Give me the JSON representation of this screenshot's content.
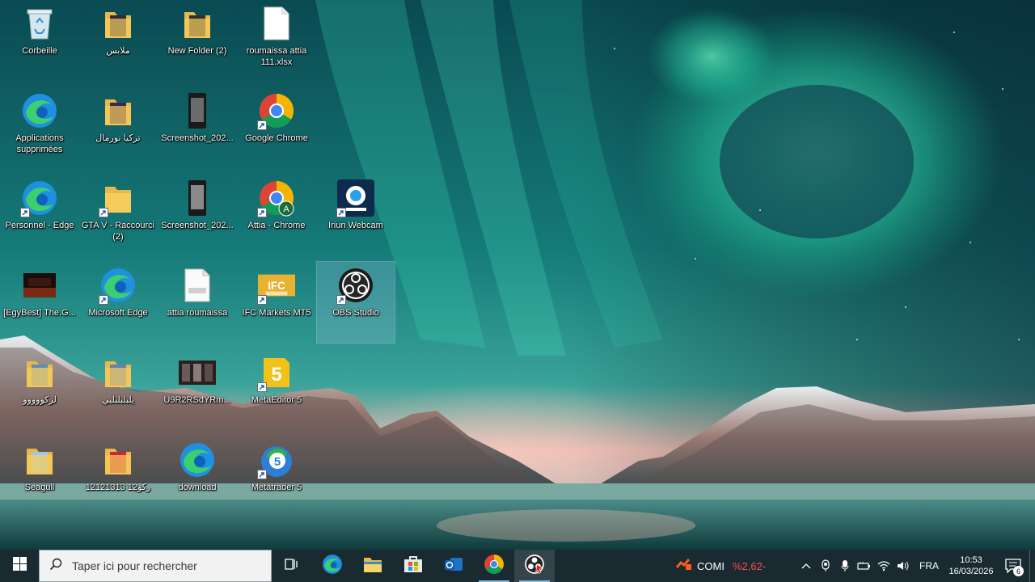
{
  "desktop": {
    "icons": [
      {
        "label": "Corbeille",
        "icon": "recycle-bin-icon"
      },
      {
        "label": "ملابس",
        "icon": "folder-icon"
      },
      {
        "label": "New Folder (2)",
        "icon": "folder-icon"
      },
      {
        "label": "roumaissa attia 111.xlsx",
        "icon": "file-icon"
      },
      {
        "label": "Applications supprimées",
        "icon": "edge-icon"
      },
      {
        "label": "تركيا نورمال",
        "icon": "folder-icon"
      },
      {
        "label": "Screenshot_202...",
        "icon": "phone-screenshot-icon"
      },
      {
        "label": "Google Chrome",
        "icon": "chrome-icon"
      },
      {
        "label": "Personnel - Edge",
        "icon": "edge-icon"
      },
      {
        "label": "GTA V - Raccourci (2)",
        "icon": "folder-icon"
      },
      {
        "label": "Screenshot_202...",
        "icon": "phone-screenshot-icon"
      },
      {
        "label": "Attia - Chrome",
        "icon": "chrome-profile-icon"
      },
      {
        "label": "Iriun Webcam",
        "icon": "webcam-icon"
      },
      {
        "label": "[EgyBest] The.G...",
        "icon": "video-icon"
      },
      {
        "label": "Microsoft Edge",
        "icon": "edge-icon"
      },
      {
        "label": "attia roumaissa",
        "icon": "docx-icon"
      },
      {
        "label": "IFC Markets MT5",
        "icon": "mt5-broker-icon"
      },
      {
        "label": "OBS Studio",
        "icon": "obs-icon"
      },
      {
        "label": "لركووووو",
        "icon": "folder-icon"
      },
      {
        "label": "يلبلبلبلبي",
        "icon": "folder-icon"
      },
      {
        "label": "U9R2RSdYRm...",
        "icon": "image-thumbnail-icon"
      },
      {
        "label": "MetaEditor 5",
        "icon": "metaeditor-icon"
      },
      {
        "label": "Seagull",
        "icon": "folder-icon"
      },
      {
        "label": "12121313 12ركو",
        "icon": "folder-icon"
      },
      {
        "label": "download",
        "icon": "edge-icon"
      },
      {
        "label": "Metatrader 5",
        "icon": "metatrader-icon"
      }
    ]
  },
  "taskbar": {
    "search_placeholder": "Taper ici pour rechercher",
    "apps": [
      {
        "name": "task-view-icon"
      },
      {
        "name": "edge-icon"
      },
      {
        "name": "file-explorer-icon"
      },
      {
        "name": "microsoft-store-icon"
      },
      {
        "name": "outlook-icon"
      },
      {
        "name": "chrome-icon"
      },
      {
        "name": "obs-icon"
      }
    ],
    "ticker": {
      "name": "COMI",
      "value": "%2,62-"
    },
    "language": "FRA",
    "time": "10:53",
    "date": "16/03/2026",
    "notification_count": "6"
  }
}
